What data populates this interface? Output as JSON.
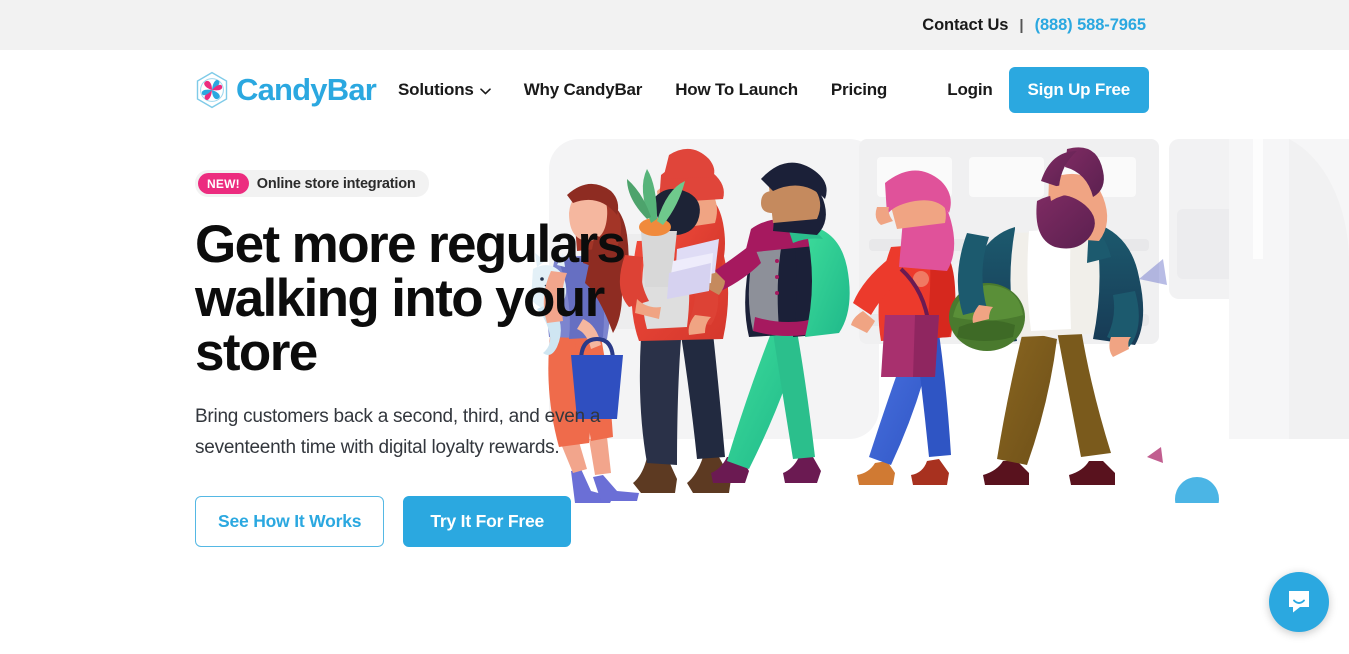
{
  "topbar": {
    "contact_label": "Contact Us",
    "separator": "|",
    "phone": "(888) 588-7965"
  },
  "nav": {
    "brand_name": "CandyBar",
    "brand_icon": "candy-pinwheel-hexagon-logo",
    "links": [
      {
        "label": "Solutions",
        "has_dropdown": true,
        "icon": "chevron-down-icon"
      },
      {
        "label": "Why CandyBar",
        "has_dropdown": false
      },
      {
        "label": "How To Launch",
        "has_dropdown": false
      },
      {
        "label": "Pricing",
        "has_dropdown": false
      }
    ],
    "login_label": "Login",
    "signup_label": "Sign Up Free"
  },
  "hero": {
    "badge_tag": "NEW!",
    "badge_label": "Online store integration",
    "headline": "Get more regulars walking into your store",
    "subhead": "Bring customers back a second, third, and even a seventeenth time with digital loyalty rewards.",
    "cta_secondary": "See How It Works",
    "cta_primary": "Try It For Free",
    "illustration": "five-shoppers-walking-in-store-flat-illustration"
  },
  "chat": {
    "icon": "chat-bubble-smile-icon",
    "aria_label": "Open Intercom Messenger"
  },
  "colors": {
    "brand_blue": "#2BA8E0",
    "badge_pink": "#EC2C7F",
    "topbar_gray": "#F2F2F2",
    "text_dark": "#0C0C0C",
    "body_text": "#33373D"
  }
}
